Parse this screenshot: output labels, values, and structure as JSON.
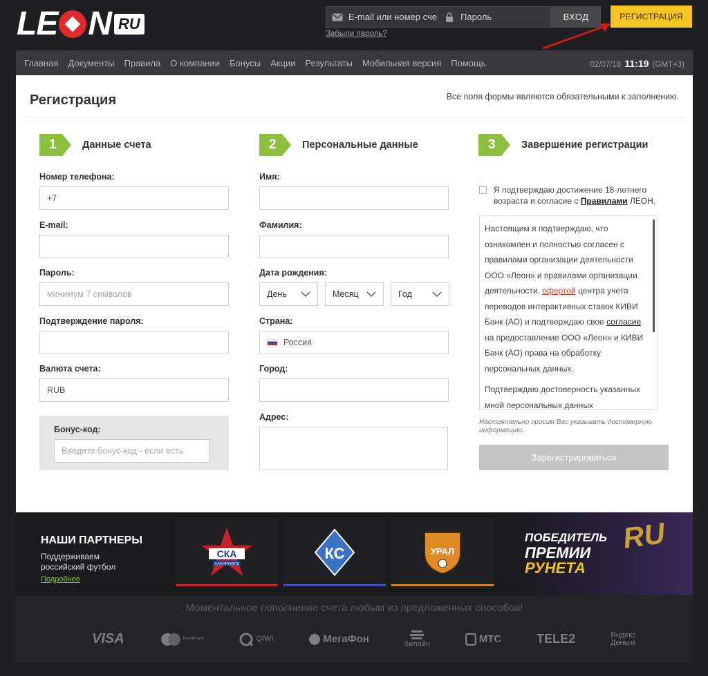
{
  "brand": {
    "logo_main_left": "LE",
    "logo_main_right": "N",
    "logo_suffix": "RU"
  },
  "header": {
    "email_placeholder": "E-mail или номер сче",
    "password_placeholder": "Пароль",
    "login_label": "ВХОД",
    "register_label": "РЕГИСТРАЦИЯ",
    "forgot_label": "Забыли пароль?"
  },
  "nav": {
    "items": [
      "Главная",
      "Документы",
      "Правила",
      "О компании",
      "Бонусы",
      "Акции",
      "Результаты",
      "Мобильная версия",
      "Помощь"
    ],
    "date": "02/07/18",
    "time": "11:19",
    "tz": "(GMT+3)"
  },
  "form": {
    "title": "Регистрация",
    "required_note": "Все поля формы являются обязательными к заполнению.",
    "steps": [
      {
        "num": "1",
        "label": "Данные счета"
      },
      {
        "num": "2",
        "label": "Персональные данные"
      },
      {
        "num": "3",
        "label": "Завершение регистрации"
      }
    ],
    "col1": {
      "phone_label": "Номер телефона:",
      "phone_value": "+7",
      "email_label": "E-mail:",
      "email_value": "",
      "password_label": "Пароль:",
      "password_placeholder": "минимум 7 символов",
      "confirm_label": "Подтверждение пароля:",
      "confirm_value": "",
      "currency_label": "Валюта счета:",
      "currency_value": "RUB",
      "bonus_label": "Бонус-код:",
      "bonus_placeholder": "Введите бонус-код - если есть"
    },
    "col2": {
      "first_name_label": "Имя:",
      "last_name_label": "Фамилия:",
      "birth_label": "Дата рождения:",
      "day": "День",
      "month": "Месяц",
      "year": "Год",
      "country_label": "Страна:",
      "country_value": "Россия",
      "city_label": "Город:",
      "address_label": "Адрес:"
    },
    "col3": {
      "agree_text_1": "Я подтверждаю достижение 18-летнего возраста и согласие с ",
      "agree_link": "Правилами",
      "agree_text_2": " ЛЕОН.",
      "terms_p1_a": "Настоящим я подтверждаю, что ознакомлен и полностью согласен с правилами организации деятельности ООО «Леон» и правилами организации деятельности, ",
      "terms_p1_link": "офертой",
      "terms_p1_b": " центра учета переводов интерактивных ставок КИВИ Банк (АО) и подтверждаю свое ",
      "terms_p1_link2": "согласие",
      "terms_p1_c": " на предоставление ООО «Леон» и КИВИ Банк (АО) права на обработку персональных данных.",
      "terms_p2": "Подтверждаю достоверность указанных мной персональных данных",
      "hint": "Настоятельно просим Вас указывать достоверную информацию.",
      "submit_label": "Зарегистрироваться"
    }
  },
  "partners": {
    "title": "НАШИ ПАРТНЕРЫ",
    "subtitle": "Поддерживаем российский футбол",
    "more": "Подробнее",
    "clubs": [
      {
        "name": "СКА",
        "sub": "ХАБАРОВСК",
        "bar_color": "#c8202b"
      },
      {
        "name": "КС",
        "sub": "",
        "bar_color": "#4a4ab8"
      },
      {
        "name": "УРАЛ",
        "sub": "",
        "bar_color": "#d4841f"
      }
    ],
    "premia_line1": "ПОБЕДИТЕЛЬ",
    "premia_line2": "ПРЕМИИ",
    "premia_line3": "РУНЕТА",
    "premia_ru": "RU"
  },
  "payments": {
    "title": "Моментальное пополнение счета любым из предложенных способов!",
    "methods": [
      "VISA",
      "mastercard",
      "QIWI",
      "МегаФон",
      "билайн",
      "МТС",
      "TELE2",
      "Яндекс Деньги"
    ]
  }
}
